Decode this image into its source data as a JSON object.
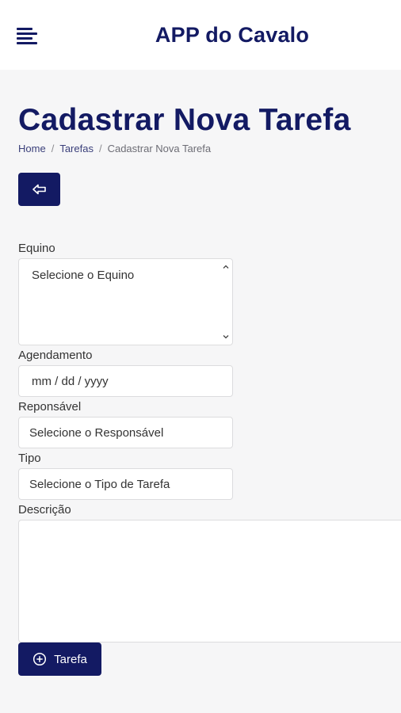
{
  "header": {
    "app_title": "APP do Cavalo",
    "menu_icon": "menu-icon"
  },
  "page": {
    "title": "Cadastrar Nova Tarefa",
    "back_icon": "arrow-left-icon"
  },
  "breadcrumb": {
    "items": [
      "Home",
      "Tarefas",
      "Cadastrar Nova Tarefa"
    ],
    "separator": "/"
  },
  "form": {
    "equino": {
      "label": "Equino",
      "value": "Selecione o Equino"
    },
    "agendamento": {
      "label": "Agendamento",
      "placeholder": "mm / dd / yyyy"
    },
    "responsavel": {
      "label": "Reponsável",
      "value": "Selecione o Responsável"
    },
    "tipo": {
      "label": "Tipo",
      "value": "Selecione o Tipo de Tarefa"
    },
    "descricao": {
      "label": "Descrição",
      "value": ""
    },
    "submit": {
      "label": "Tarefa",
      "icon": "plus-circle-icon"
    }
  },
  "colors": {
    "brand": "#131a63",
    "background": "#f6f6f7",
    "header_bg": "#ffffff"
  }
}
